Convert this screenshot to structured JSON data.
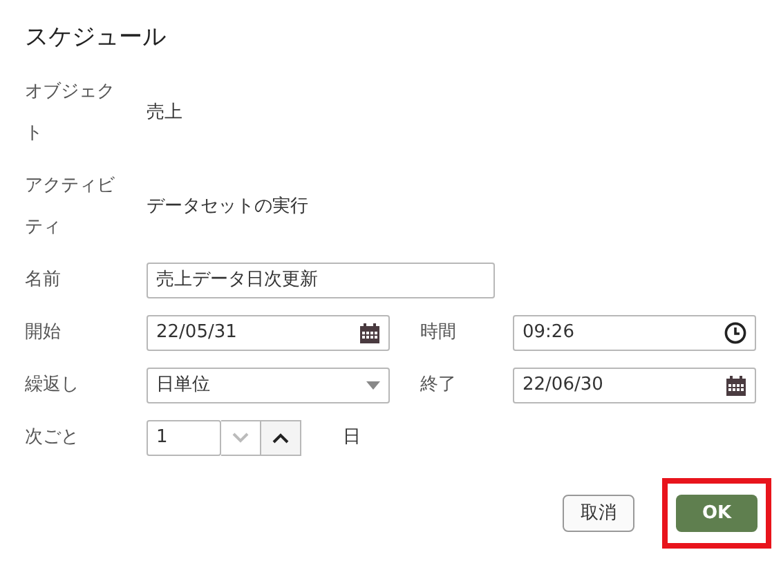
{
  "dialog": {
    "title": "スケジュール"
  },
  "fields": [
    {
      "kind": "text",
      "label": "オブジェクト",
      "value": "売上"
    },
    {
      "kind": "text",
      "label": "アクティビティ",
      "value": "データセットの実行"
    },
    {
      "kind": "input",
      "label": "名前",
      "value": "売上データ日次更新"
    },
    {
      "kind": "date",
      "label": "開始",
      "value": "22/05/31"
    },
    {
      "kind": "time",
      "label": "時間",
      "value": "09:26"
    },
    {
      "kind": "select",
      "label": "繰返し",
      "value": "日単位"
    },
    {
      "kind": "date",
      "label": "終了",
      "value": "22/06/30"
    },
    {
      "kind": "spinner",
      "label": "次ごと",
      "value": "1",
      "unit": "日",
      "down_disabled": true,
      "up_disabled": false
    }
  ],
  "buttons": [
    {
      "label": "取消",
      "kind": "secondary",
      "highlighted": false
    },
    {
      "label": "OK",
      "kind": "primary",
      "highlighted": true
    }
  ]
}
